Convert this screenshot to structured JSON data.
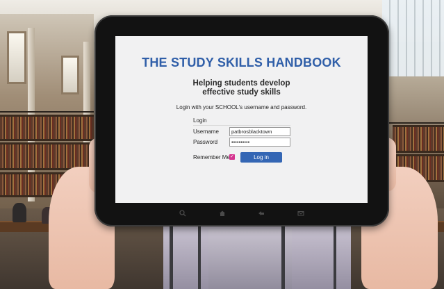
{
  "screen": {
    "title": "THE STUDY SKILLS HANDBOOK",
    "subtitle_line1": "Helping students develop",
    "subtitle_line2": "effective study skills",
    "instruction": "Login with your SCHOOL's username and password.",
    "login": {
      "heading": "Login",
      "username_label": "Username",
      "username_value": "patbrosblacktown",
      "password_label": "Password",
      "password_value": "••••••••••",
      "remember_label": "Remember Me",
      "remember_checked": true,
      "button_label": "Log in"
    }
  },
  "tablet_nav": {
    "icons": [
      "search-icon",
      "home-icon",
      "back-icon",
      "mail-icon"
    ]
  },
  "colors": {
    "title": "#2f5ea8",
    "button": "#3466b4",
    "checkbox": "#d5338f"
  }
}
